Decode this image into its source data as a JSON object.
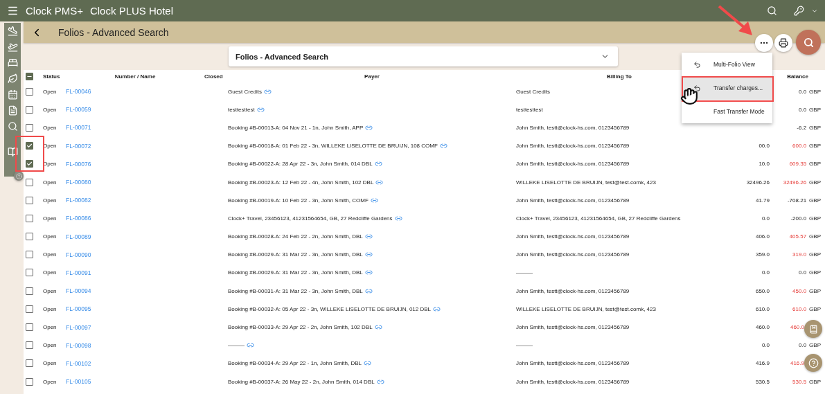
{
  "app_bar": {
    "app_name": "Clock PMS+",
    "hotel": "Clock PLUS Hotel"
  },
  "page_header": {
    "title": "Folios - Advanced Search"
  },
  "search_panel": {
    "title": "Folios - Advanced Search",
    "expanded": false
  },
  "menu": {
    "items": [
      {
        "label": "Multi-Folio View",
        "kind": "undo",
        "selected": false
      },
      {
        "label": "Transfer charges...",
        "kind": "undo",
        "selected": true
      },
      {
        "label": "Fast Transfer Mode",
        "kind": "plain",
        "selected": false
      }
    ]
  },
  "table": {
    "select_all": {
      "indeterminate": true
    },
    "columns": [
      "Status",
      "Number / Name",
      "Closed",
      "Payer",
      "Billing To",
      "Balance"
    ],
    "rows": [
      {
        "checked": false,
        "status": "Open",
        "number": "FL-00046",
        "payer": "Guest Credits",
        "billing": "Guest Credits",
        "balance": "0.0",
        "currency": "GBP",
        "due": false
      },
      {
        "checked": false,
        "status": "Open",
        "number": "FL-00059",
        "payer": "testtesttest",
        "billing": "testtesttest",
        "balance": "0.0",
        "currency": "GBP",
        "due": false
      },
      {
        "checked": false,
        "status": "Open",
        "number": "FL-00071",
        "payer": "Booking #B-00013-A: 04 Nov 21 - 1n, John Smith, APP",
        "billing": "John Smith, testt@clock-hs.com, 0123456789",
        "balance": "-6.2",
        "currency": "GBP",
        "due": false
      },
      {
        "checked": true,
        "status": "Open",
        "number": "FL-00072",
        "payer": "Booking #B-00018-A: 01 Feb 22 - 3n, WILLEKE LISELOTTE DE BRUIJN, 108 COMF",
        "billing": "John Smith, testt@clock-hs.com, 0123456789",
        "charges": "00.0",
        "balance": "600.0",
        "currency": "GBP",
        "due": true
      },
      {
        "checked": true,
        "status": "Open",
        "number": "FL-00076",
        "payer": "Booking #B-00022-A: 28 Apr 22 - 3n, John Smith, 014 DBL",
        "billing": "John Smith, testt@clock-hs.com, 0123456789",
        "charges": "10.0",
        "balance": "609.35",
        "currency": "GBP",
        "due": true
      },
      {
        "checked": false,
        "status": "Open",
        "number": "FL-00080",
        "payer": "Booking #B-00023-A: 12 Feb 22 - 4n, John Smith, 102 DBL",
        "billing": "WILLEKE LISELOTTE DE BRUIJN, test@test.comk, 423",
        "charges": "32496.26",
        "balance": "32496.26",
        "currency": "GBP",
        "due": true
      },
      {
        "checked": false,
        "status": "Open",
        "number": "FL-00082",
        "payer": "Booking #B-00019-A: 10 Feb 22 - 3n, John Smith, COMF",
        "billing": "John Smith, testt@clock-hs.com, 0123456789",
        "charges": "41.79",
        "balance": "-708.21",
        "currency": "GBP",
        "due": false
      },
      {
        "checked": false,
        "status": "Open",
        "number": "FL-00086",
        "payer": "Clock+ Travel, 23456123, 41231564654, GB, 27 Redcliffe Gardens",
        "billing": "Clock+ Travel, 23456123, 41231564654, GB, 27 Redcliffe Gardens",
        "charges": "0.0",
        "balance": "-200.0",
        "currency": "GBP",
        "due": false
      },
      {
        "checked": false,
        "status": "Open",
        "number": "FL-00089",
        "payer": "Booking #B-00028-A: 24 Feb 22 - 2n, John Smith, DBL",
        "billing": "John Smith, testt@clock-hs.com, 0123456789",
        "charges": "406.0",
        "balance": "405.57",
        "currency": "GBP",
        "due": true
      },
      {
        "checked": false,
        "status": "Open",
        "number": "FL-00090",
        "payer": "Booking #B-00029-A: 31 Mar 22 - 3n, John Smith, DBL",
        "billing": "John Smith, testt@clock-hs.com, 0123456789",
        "charges": "359.0",
        "balance": "319.0",
        "currency": "GBP",
        "due": true
      },
      {
        "checked": false,
        "status": "Open",
        "number": "FL-00091",
        "payer": "Booking #B-00029-A: 31 Mar 22 - 3n, John Smith, DBL",
        "billing": "———",
        "charges": "0.0",
        "balance": "0.0",
        "currency": "GBP",
        "due": false
      },
      {
        "checked": false,
        "status": "Open",
        "number": "FL-00094",
        "payer": "Booking #B-00031-A: 31 Mar 22 - 3n, John Smith, DBL",
        "billing": "John Smith, testt@clock-hs.com, 0123456789",
        "charges": "650.0",
        "balance": "450.0",
        "currency": "GBP",
        "due": true
      },
      {
        "checked": false,
        "status": "Open",
        "number": "FL-00095",
        "payer": "Booking #B-00032-A: 05 Apr 22 - 3n, WILLEKE LISELOTTE DE BRUIJN, 012 DBL",
        "billing": "WILLEKE LISELOTTE DE BRUIJN, test@test.comk, 423",
        "charges": "610.0",
        "balance": "610.0",
        "currency": "GBP",
        "due": true
      },
      {
        "checked": false,
        "status": "Open",
        "number": "FL-00097",
        "payer": "Booking #B-00033-A: 29 Apr 22 - 2n, John Smith, 102 DBL",
        "billing": "John Smith, testt@clock-hs.com, 0123456789",
        "charges": "460.0",
        "balance": "460.0",
        "due": true
      },
      {
        "checked": false,
        "status": "Open",
        "number": "FL-00098",
        "payer": "———",
        "billing": "———",
        "charges": "0.0",
        "balance": "0.0",
        "currency": "GBP",
        "due": false
      },
      {
        "checked": false,
        "status": "Open",
        "number": "FL-00102",
        "payer": "Booking #B-00034-A: 29 Apr 22 - 1n, John Smith, DBL",
        "billing": "John Smith, testt@clock-hs.com, 0123456789",
        "charges": "416.9",
        "balance": "416.9",
        "due": true
      },
      {
        "checked": false,
        "status": "Open",
        "number": "FL-00105",
        "payer": "Booking #B-00037-A: 26 May 22 - 2n, John Smith, 014 DBL",
        "billing": "John Smith, testt@clock-hs.com, 0123456789",
        "charges": "530.5",
        "balance": "530.5",
        "currency": "GBP",
        "due": true
      }
    ]
  }
}
